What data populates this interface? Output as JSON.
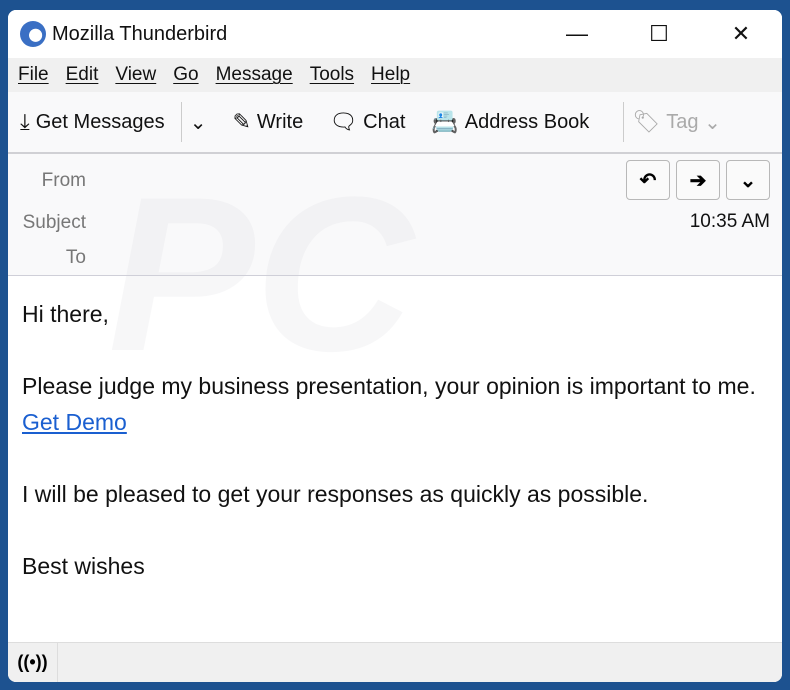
{
  "window": {
    "title": "Mozilla Thunderbird"
  },
  "menu": [
    "File",
    "Edit",
    "View",
    "Go",
    "Message",
    "Tools",
    "Help"
  ],
  "toolbar": {
    "get_messages": "Get Messages",
    "write": "Write",
    "chat": "Chat",
    "address_book": "Address Book",
    "tag": "Tag"
  },
  "header": {
    "from_label": "From",
    "subject_label": "Subject",
    "to_label": "To",
    "time": "10:35 AM"
  },
  "message": {
    "greeting": "Hi there,",
    "line1": "Please judge my business presentation, your opinion is important to me.",
    "link": "Get Demo",
    "line2": "I will be pleased to get your responses as quickly as possible.",
    "signoff": "Best wishes"
  },
  "colors": {
    "background": "#1d5290",
    "link": "#1a5fd0"
  }
}
